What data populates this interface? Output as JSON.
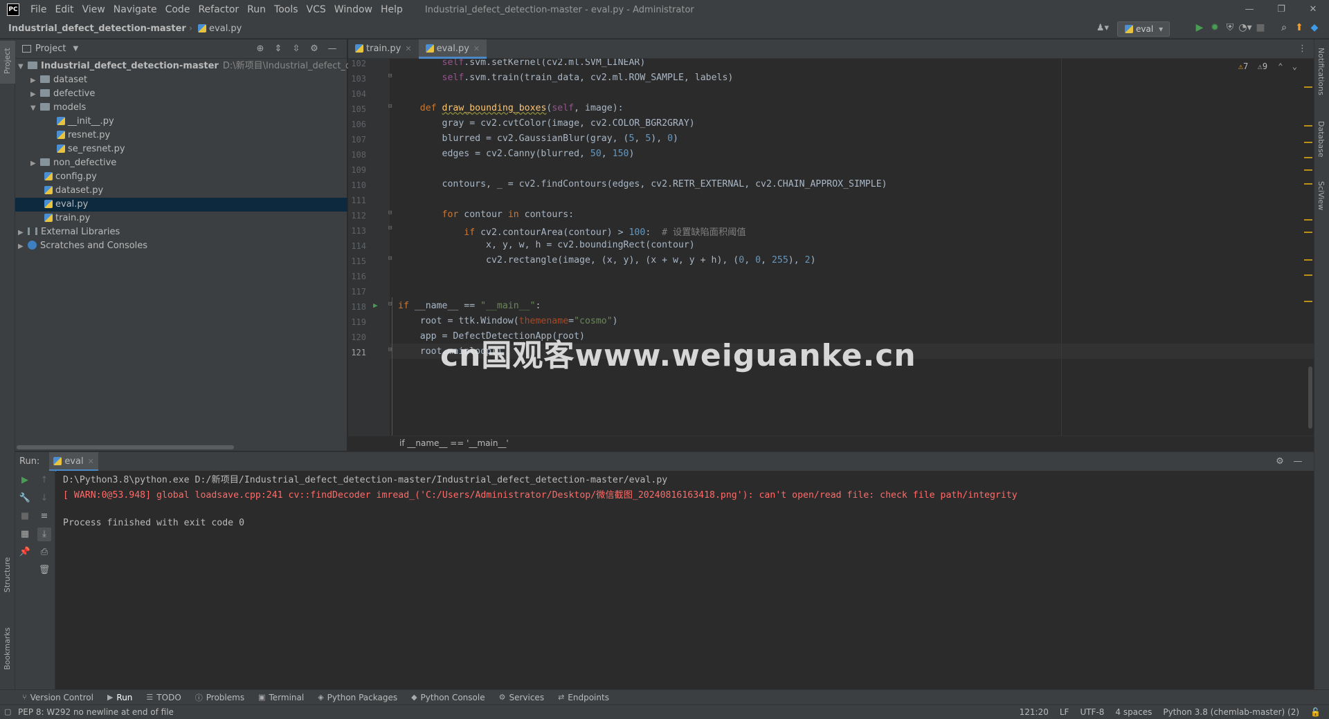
{
  "window": {
    "title": "Industrial_defect_detection-master - eval.py - Administrator",
    "app_logo": "PC",
    "menu": [
      "File",
      "Edit",
      "View",
      "Navigate",
      "Code",
      "Refactor",
      "Run",
      "Tools",
      "VCS",
      "Window",
      "Help"
    ]
  },
  "navbar": {
    "project": "Industrial_defect_detection-master",
    "file": "eval.py",
    "run_config": "eval"
  },
  "project_panel": {
    "title": "Project",
    "root": {
      "name": "Industrial_defect_detection-master",
      "path": "D:\\新项目\\Industrial_defect_detection-m"
    },
    "items": [
      {
        "name": "dataset",
        "type": "folder"
      },
      {
        "name": "defective",
        "type": "folder"
      },
      {
        "name": "models",
        "type": "folder"
      },
      {
        "name": "__init__.py",
        "type": "file"
      },
      {
        "name": "resnet.py",
        "type": "file"
      },
      {
        "name": "se_resnet.py",
        "type": "file"
      },
      {
        "name": "non_defective",
        "type": "folder"
      },
      {
        "name": "config.py",
        "type": "file"
      },
      {
        "name": "dataset.py",
        "type": "file"
      },
      {
        "name": "eval.py",
        "type": "file"
      },
      {
        "name": "train.py",
        "type": "file"
      },
      {
        "name": "External Libraries",
        "type": "lib"
      },
      {
        "name": "Scratches and Consoles",
        "type": "scratch"
      }
    ]
  },
  "editor": {
    "tabs": [
      {
        "label": "train.py"
      },
      {
        "label": "eval.py"
      }
    ],
    "inspections": {
      "warnings": "7",
      "weak_warnings": "9"
    },
    "line_numbers": [
      "102",
      "103",
      "104",
      "105",
      "106",
      "107",
      "108",
      "109",
      "110",
      "111",
      "112",
      "113",
      "114",
      "115",
      "116",
      "117",
      "118",
      "119",
      "120",
      "121"
    ],
    "breadcrumb": "if __name__ == '__main__'"
  },
  "run_panel": {
    "label": "Run:",
    "tab": "eval",
    "lines": [
      "D:\\Python3.8\\python.exe D:/新项目/Industrial_defect_detection-master/Industrial_defect_detection-master/eval.py",
      "[ WARN:0@53.948] global loadsave.cpp:241 cv::findDecoder imread_('C:/Users/Administrator/Desktop/微信截图_20240816163418.png'): can't open/read file: check file path/integrity",
      "",
      "Process finished with exit code 0"
    ]
  },
  "tool_tabs": [
    "Version Control",
    "Run",
    "TODO",
    "Problems",
    "Terminal",
    "Python Packages",
    "Python Console",
    "Services",
    "Endpoints"
  ],
  "side_tabs": {
    "left_top": "Project",
    "left_bottom_1": "Structure",
    "left_bottom_2": "Bookmarks",
    "right_1": "Notifications",
    "right_2": "Database",
    "right_3": "SciView"
  },
  "status": {
    "message": "PEP 8: W292 no newline at end of file",
    "position": "121:20",
    "line_sep": "LF",
    "encoding": "UTF-8",
    "indent": "4 spaces",
    "interpreter": "Python 3.8 (chemlab-master) (2)"
  },
  "watermark": "cn国观客www.weiguanke.cn",
  "colors": {
    "accent": "#4a88c7",
    "error_text": "#ff6b68",
    "keyword": "#cc7832",
    "function": "#ffc66d"
  }
}
